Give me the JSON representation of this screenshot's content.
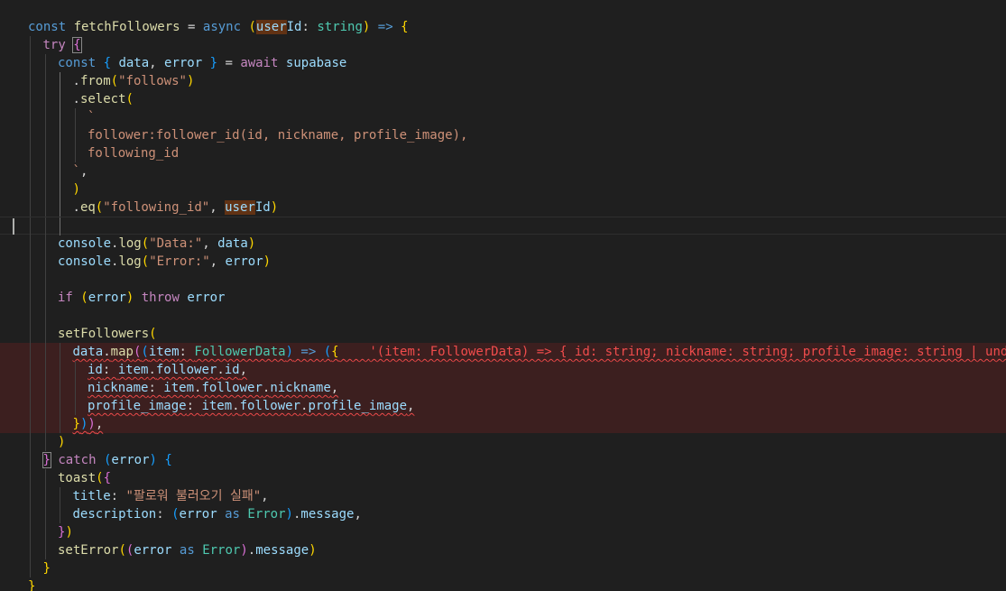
{
  "editor": {
    "lines": [
      {
        "indent": 1,
        "tokens": [
          [
            "kw",
            "const "
          ],
          [
            "fn",
            "fetchFollowers"
          ],
          [
            "punc",
            " = "
          ],
          [
            "kw",
            "async "
          ],
          [
            "b1",
            "("
          ],
          [
            "var",
            "user",
            "hl"
          ],
          [
            "var",
            "Id"
          ],
          [
            "punc",
            ": "
          ],
          [
            "type",
            "string"
          ],
          [
            "b1",
            ")"
          ],
          [
            "kw",
            " => "
          ],
          [
            "b1",
            "{"
          ]
        ]
      },
      {
        "indent": 2,
        "tokens": [
          [
            "ctl",
            "try "
          ],
          [
            "b2",
            "{",
            "bm"
          ]
        ]
      },
      {
        "indent": 3,
        "tokens": [
          [
            "kw",
            "const "
          ],
          [
            "b3",
            "{ "
          ],
          [
            "var",
            "data"
          ],
          [
            "punc",
            ", "
          ],
          [
            "var",
            "error"
          ],
          [
            "b3",
            " }"
          ],
          [
            "punc",
            " = "
          ],
          [
            "ctl",
            "await "
          ],
          [
            "var",
            "supabase"
          ]
        ]
      },
      {
        "indent": 4,
        "tokens": [
          [
            "punc",
            "."
          ],
          [
            "fn",
            "from"
          ],
          [
            "b1",
            "("
          ],
          [
            "str",
            "\"follows\""
          ],
          [
            "b1",
            ")"
          ]
        ]
      },
      {
        "indent": 4,
        "tokens": [
          [
            "punc",
            "."
          ],
          [
            "fn",
            "select"
          ],
          [
            "b1",
            "("
          ]
        ]
      },
      {
        "indent": 5,
        "tokens": [
          [
            "str",
            "`"
          ]
        ]
      },
      {
        "indent": 5,
        "tokens": [
          [
            "str",
            "follower:follower_id(id, nickname, profile_image),"
          ]
        ]
      },
      {
        "indent": 5,
        "tokens": [
          [
            "str",
            "following_id"
          ]
        ]
      },
      {
        "indent": 4,
        "tokens": [
          [
            "str",
            "`"
          ],
          [
            "punc",
            ","
          ]
        ]
      },
      {
        "indent": 4,
        "tokens": [
          [
            "b1",
            ")"
          ]
        ]
      },
      {
        "indent": 4,
        "tokens": [
          [
            "punc",
            "."
          ],
          [
            "fn",
            "eq"
          ],
          [
            "b1",
            "("
          ],
          [
            "str",
            "\"following_id\""
          ],
          [
            "punc",
            ", "
          ],
          [
            "var",
            "user",
            "hl"
          ],
          [
            "var",
            "Id"
          ],
          [
            "b1",
            ")"
          ]
        ]
      },
      {
        "indent": 0,
        "tokens": []
      },
      {
        "indent": 3,
        "tokens": [
          [
            "var",
            "console"
          ],
          [
            "punc",
            "."
          ],
          [
            "fn",
            "log"
          ],
          [
            "b1",
            "("
          ],
          [
            "str",
            "\"Data:\""
          ],
          [
            "punc",
            ", "
          ],
          [
            "var",
            "data"
          ],
          [
            "b1",
            ")"
          ]
        ]
      },
      {
        "indent": 3,
        "tokens": [
          [
            "var",
            "console"
          ],
          [
            "punc",
            "."
          ],
          [
            "fn",
            "log"
          ],
          [
            "b1",
            "("
          ],
          [
            "str",
            "\"Error:\""
          ],
          [
            "punc",
            ", "
          ],
          [
            "var",
            "error"
          ],
          [
            "b1",
            ")"
          ]
        ]
      },
      {
        "indent": 0,
        "tokens": []
      },
      {
        "indent": 3,
        "tokens": [
          [
            "ctl",
            "if "
          ],
          [
            "b1",
            "("
          ],
          [
            "var",
            "error"
          ],
          [
            "b1",
            ")"
          ],
          [
            "ctl",
            " throw "
          ],
          [
            "var",
            "error"
          ]
        ]
      },
      {
        "indent": 0,
        "tokens": []
      },
      {
        "indent": 3,
        "tokens": [
          [
            "fn",
            "setFollowers"
          ],
          [
            "b1",
            "("
          ]
        ]
      },
      {
        "indent": 4,
        "tokens": [
          [
            "var",
            "data"
          ],
          [
            "punc",
            "."
          ],
          [
            "fn",
            "map"
          ],
          [
            "b2",
            "("
          ],
          [
            "b3",
            "("
          ],
          [
            "var",
            "item"
          ],
          [
            "punc",
            ": "
          ],
          [
            "type",
            "FollowerData"
          ],
          [
            "b3",
            ")"
          ],
          [
            "kw",
            " => "
          ],
          [
            "b3",
            "("
          ],
          [
            "b1",
            "{"
          ]
        ],
        "inlay": "'(item: FollowerData) => { id: string; nickname: string; profile_image: string | undef"
      },
      {
        "indent": 5,
        "tokens": [
          [
            "prop",
            "id"
          ],
          [
            "punc",
            ": "
          ],
          [
            "var",
            "item"
          ],
          [
            "punc",
            "."
          ],
          [
            "var",
            "follower"
          ],
          [
            "punc",
            "."
          ],
          [
            "var",
            "id"
          ],
          [
            "punc",
            ","
          ]
        ]
      },
      {
        "indent": 5,
        "tokens": [
          [
            "prop",
            "nickname"
          ],
          [
            "punc",
            ": "
          ],
          [
            "var",
            "item"
          ],
          [
            "punc",
            "."
          ],
          [
            "var",
            "follower"
          ],
          [
            "punc",
            "."
          ],
          [
            "var",
            "nickname"
          ],
          [
            "punc",
            ","
          ]
        ]
      },
      {
        "indent": 5,
        "tokens": [
          [
            "prop",
            "profile_image"
          ],
          [
            "punc",
            ": "
          ],
          [
            "var",
            "item"
          ],
          [
            "punc",
            "."
          ],
          [
            "var",
            "follower"
          ],
          [
            "punc",
            "."
          ],
          [
            "var",
            "profile_image"
          ],
          [
            "punc",
            ","
          ]
        ]
      },
      {
        "indent": 4,
        "tokens": [
          [
            "b1",
            "}"
          ],
          [
            "b3",
            ")"
          ],
          [
            "b2",
            ")"
          ],
          [
            "punc",
            ","
          ]
        ]
      },
      {
        "indent": 3,
        "tokens": [
          [
            "b1",
            ")"
          ]
        ]
      },
      {
        "indent": 2,
        "tokens": [
          [
            "b2",
            "}",
            "bm"
          ],
          [
            "ctl",
            " catch "
          ],
          [
            "b3",
            "("
          ],
          [
            "var",
            "error"
          ],
          [
            "b3",
            ")"
          ],
          [
            "punc",
            " "
          ],
          [
            "b3",
            "{"
          ]
        ]
      },
      {
        "indent": 3,
        "tokens": [
          [
            "fn",
            "toast"
          ],
          [
            "b1",
            "("
          ],
          [
            "b2",
            "{"
          ]
        ]
      },
      {
        "indent": 4,
        "tokens": [
          [
            "prop",
            "title"
          ],
          [
            "punc",
            ": "
          ],
          [
            "str",
            "\"팔로워 불러오기 실패\""
          ],
          [
            "punc",
            ","
          ]
        ]
      },
      {
        "indent": 4,
        "tokens": [
          [
            "prop",
            "description"
          ],
          [
            "punc",
            ": "
          ],
          [
            "b3",
            "("
          ],
          [
            "var",
            "error"
          ],
          [
            "kw",
            " as "
          ],
          [
            "type",
            "Error"
          ],
          [
            "b3",
            ")"
          ],
          [
            "punc",
            "."
          ],
          [
            "var",
            "message"
          ],
          [
            "punc",
            ","
          ]
        ]
      },
      {
        "indent": 3,
        "tokens": [
          [
            "b2",
            "}"
          ],
          [
            "b1",
            ")"
          ]
        ]
      },
      {
        "indent": 3,
        "tokens": [
          [
            "fn",
            "setError"
          ],
          [
            "b1",
            "("
          ],
          [
            "b2",
            "("
          ],
          [
            "var",
            "error"
          ],
          [
            "kw",
            " as "
          ],
          [
            "type",
            "Error"
          ],
          [
            "b2",
            ")"
          ],
          [
            "punc",
            "."
          ],
          [
            "var",
            "message"
          ],
          [
            "b1",
            ")"
          ]
        ]
      },
      {
        "indent": 2,
        "tokens": [
          [
            "b1",
            "}"
          ]
        ]
      },
      {
        "indent": 1,
        "tokens": [
          [
            "b1",
            "}"
          ]
        ]
      }
    ]
  }
}
